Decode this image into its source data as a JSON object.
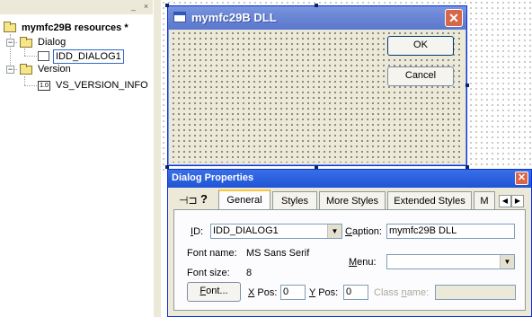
{
  "tree": {
    "root": "mymfc29B resources *",
    "nodes": [
      {
        "label": "Dialog"
      },
      {
        "label": "IDD_DIALOG1"
      },
      {
        "label": "Version"
      },
      {
        "label": "VS_VERSION_INFO"
      }
    ]
  },
  "dialog_preview": {
    "title": "mymfc29B DLL",
    "ok_label": "OK",
    "cancel_label": "Cancel"
  },
  "properties": {
    "title": "Dialog Properties",
    "tabs": [
      "General",
      "Styles",
      "More Styles",
      "Extended Styles",
      "M"
    ],
    "active_tab": "General",
    "id_label_prefix": "I",
    "id_label_rest": "D:",
    "id_value": "IDD_DIALOG1",
    "caption_label_prefix": "C",
    "caption_label_rest": "aption:",
    "caption_value": "mymfc29B DLL",
    "font_name_label": "Font name:",
    "font_name_value": "MS Sans Serif",
    "font_size_label": "Font size:",
    "font_size_value": "8",
    "menu_label_prefix": "M",
    "menu_label_rest": "enu:",
    "menu_value": "",
    "font_button_prefix": "F",
    "font_button_rest": "ont...",
    "xpos_label_prefix": "X",
    "xpos_label_rest": " Pos:",
    "xpos_value": "0",
    "ypos_label_prefix": "Y",
    "ypos_label_rest": " Pos:",
    "ypos_value": "0",
    "class_name_label_prefix": "Class ",
    "class_name_label_u": "n",
    "class_name_label_rest": "ame:",
    "class_name_value": ""
  },
  "icons": [
    "folder-icon",
    "dialog-resource-icon",
    "version-resource-icon",
    "pin-icon",
    "help-icon",
    "close-icon"
  ]
}
